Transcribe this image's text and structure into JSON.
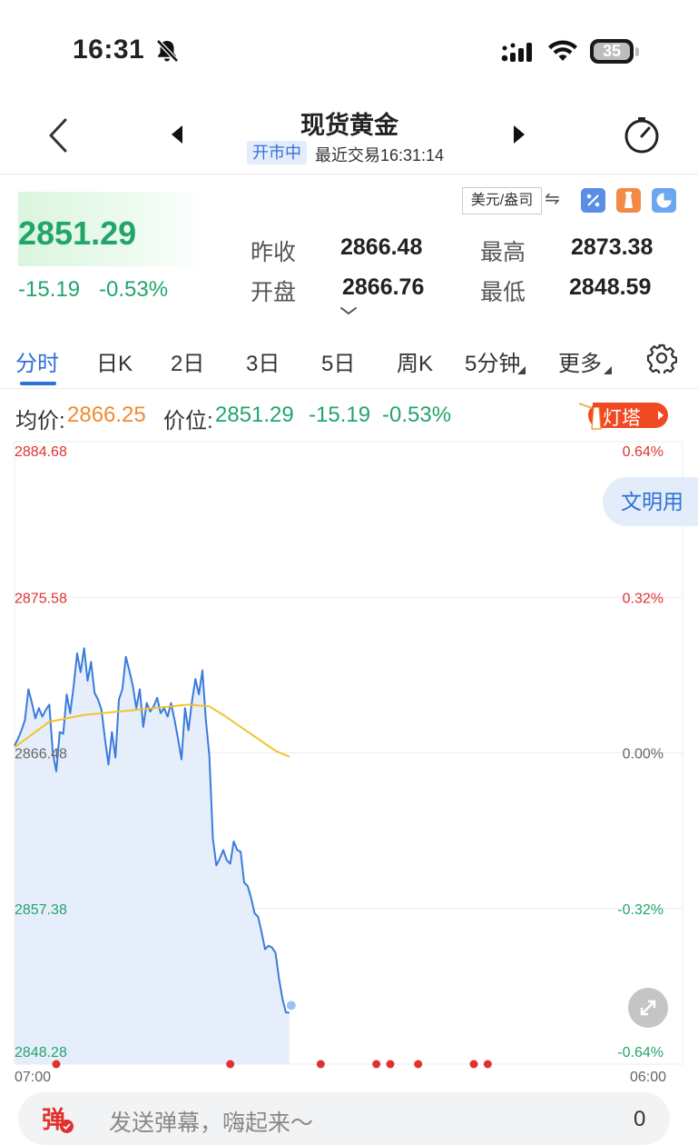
{
  "status_bar": {
    "time": "16:31",
    "battery": "35",
    "icons": [
      "bell-slash-icon",
      "cellular-signal-icon",
      "wifi-icon",
      "battery-icon"
    ]
  },
  "header": {
    "title": "现货黄金",
    "market_status": "开市中",
    "last_trade": "最近交易16:31:14",
    "icons": [
      "back-icon",
      "prev-icon",
      "next-icon",
      "refresh-timer-icon"
    ]
  },
  "quote": {
    "price": "2851.29",
    "change": "-15.19",
    "change_pct": "-0.53%",
    "unit": "美元/盎司",
    "swap_symbol": "⇋",
    "prev_close_label": "昨收",
    "prev_close": "2866.48",
    "high_label": "最高",
    "high": "2873.38",
    "open_label": "开盘",
    "open": "2866.76",
    "low_label": "最低",
    "low": "2848.59",
    "colors": {
      "down": "#22a56b",
      "up": "#e0312e"
    }
  },
  "tabs": [
    {
      "label": "分时",
      "active": true
    },
    {
      "label": "日K"
    },
    {
      "label": "2日"
    },
    {
      "label": "3日"
    },
    {
      "label": "5日"
    },
    {
      "label": "周K"
    },
    {
      "label": "5分钟",
      "dropdown": true
    },
    {
      "label": "更多",
      "dropdown": true
    }
  ],
  "info_line": {
    "avg_label": "均价:",
    "avg_value": "2866.25",
    "price_label": "价位:",
    "price_value": "2851.29",
    "change": "-15.19",
    "change_pct": "-0.53%",
    "dengta_label": "灯塔"
  },
  "chart_data": {
    "type": "line",
    "y_ticks_left": [
      "2884.68",
      "2875.58",
      "2866.48",
      "2857.38",
      "2848.28"
    ],
    "y_ticks_right": [
      "0.64%",
      "0.32%",
      "0.00%",
      "-0.32%",
      "-0.64%"
    ],
    "x_labels": [
      "07:00",
      "06:00"
    ],
    "ylim": [
      2848.28,
      2884.68
    ],
    "reference_price": 2866.48,
    "series": [
      {
        "color": "#3a7bdc",
        "x": [
          0,
          1,
          2,
          3,
          4,
          5,
          6,
          7,
          8,
          9,
          10,
          11,
          12,
          13,
          14,
          15,
          16,
          17,
          18,
          19,
          20,
          21,
          22,
          23,
          24,
          25,
          26,
          27,
          28,
          29,
          30,
          31,
          32,
          33,
          34,
          35,
          36,
          37,
          38,
          39,
          40,
          41,
          42,
          43,
          44,
          45,
          46,
          47,
          48,
          49,
          50,
          51,
          52,
          53,
          54,
          55,
          56,
          57,
          58,
          59,
          60,
          61,
          62,
          63,
          64,
          65,
          66,
          67,
          68,
          69,
          70,
          71,
          72,
          73,
          74,
          75,
          76,
          77,
          78,
          79
        ],
        "values": [
          2866.9,
          2867.3,
          2867.8,
          2868.4,
          2870.2,
          2869.4,
          2868.5,
          2869.1,
          2868.6,
          2869.0,
          2869.3,
          2866.5,
          2865.4,
          2867.7,
          2867.6,
          2869.9,
          2868.8,
          2870.4,
          2872.3,
          2871.2,
          2872.6,
          2870.7,
          2871.8,
          2870.0,
          2869.6,
          2869.0,
          2867.3,
          2865.8,
          2867.7,
          2866.2,
          2869.6,
          2870.2,
          2872.1,
          2871.3,
          2870.4,
          2869.1,
          2870.2,
          2868.0,
          2869.4,
          2868.9,
          2869.2,
          2869.7,
          2868.8,
          2869.1,
          2868.6,
          2869.4,
          2868.4,
          2867.3,
          2866.1,
          2869.1,
          2867.8,
          2869.5,
          2870.8,
          2869.9,
          2871.3,
          2868.4,
          2866.3,
          2861.5,
          2859.9,
          2860.3,
          2860.8,
          2860.2,
          2860.0,
          2861.3,
          2860.8,
          2860.7,
          2858.9,
          2858.7,
          2858.0,
          2857.1,
          2856.9,
          2856.0,
          2855.0,
          2855.2,
          2855.1,
          2854.8,
          2853.3,
          2852.1,
          2851.3,
          2851.29
        ]
      },
      {
        "color": "#f2c32c",
        "x": [
          0,
          10,
          20,
          30,
          40,
          50,
          56,
          60,
          65,
          70,
          75,
          79
        ],
        "values": [
          2866.8,
          2868.3,
          2868.7,
          2868.9,
          2869.1,
          2869.3,
          2869.2,
          2868.7,
          2868.0,
          2867.3,
          2866.6,
          2866.25
        ]
      }
    ],
    "x_total": 192,
    "event_markers_x": [
      12,
      62,
      88,
      104,
      108,
      116,
      132,
      136
    ],
    "fill_color": "#e6eefb",
    "grid": true
  },
  "chat_tag": "文明用",
  "bottom_bar": {
    "danmu_icon": "弹",
    "placeholder": "发送弹幕，嗨起来～",
    "count": "0"
  }
}
